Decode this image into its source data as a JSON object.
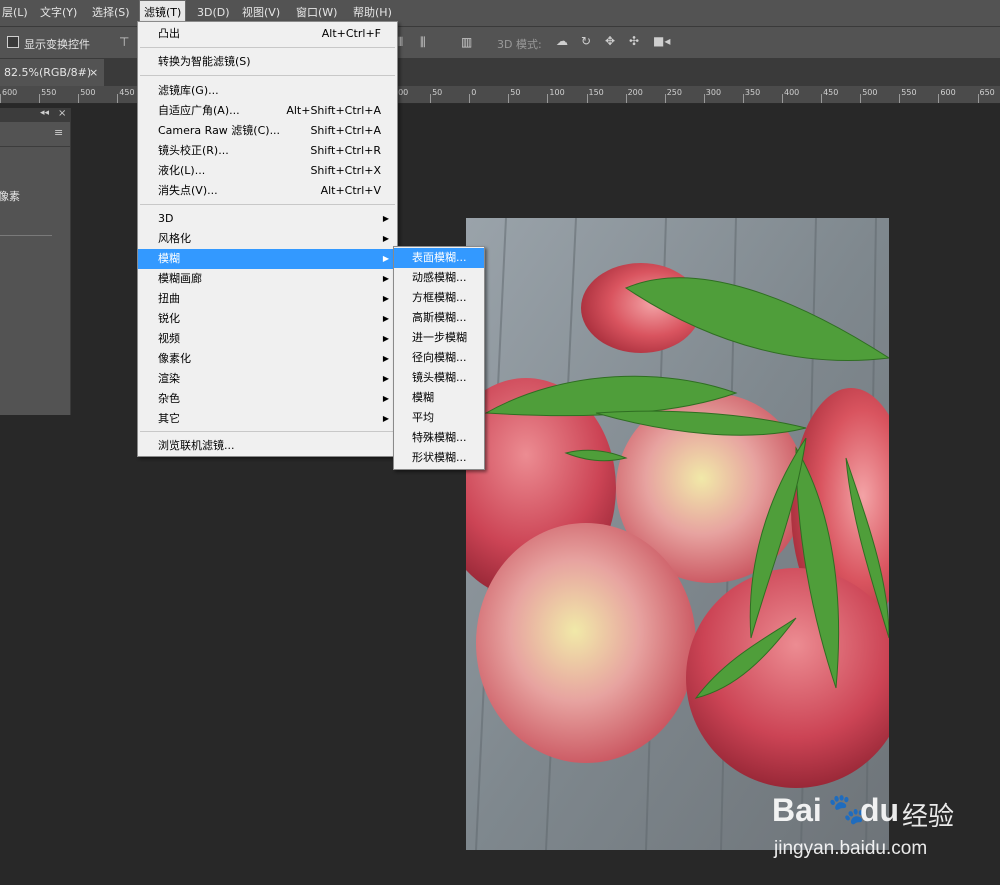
{
  "menubar": {
    "items": [
      {
        "label": "层(L)"
      },
      {
        "label": "文字(Y)"
      },
      {
        "label": "选择(S)"
      },
      {
        "label": "滤镜(T)"
      },
      {
        "label": "3D(D)"
      },
      {
        "label": "视图(V)"
      },
      {
        "label": "窗口(W)"
      },
      {
        "label": "帮助(H)"
      }
    ]
  },
  "options": {
    "show_transform_label": "显示变换控件",
    "mode_3d_label": "3D 模式:"
  },
  "document_tab": {
    "label": "82.5%(RGB/8#)",
    "close": "×"
  },
  "ruler": {
    "labels": [
      "600",
      "550",
      "500",
      "450",
      "400",
      "350",
      "300",
      "250",
      "200",
      "150",
      "100",
      "50",
      "0",
      "50",
      "100",
      "150",
      "200",
      "250",
      "300",
      "350",
      "400",
      "450",
      "500",
      "550",
      "600",
      "650"
    ]
  },
  "panel": {
    "text": "像素"
  },
  "filter_menu": {
    "items": [
      {
        "label": "凸出",
        "shortcut": "Alt+Ctrl+F"
      },
      {
        "label": "转换为智能滤镜(S)",
        "shortcut": ""
      },
      {
        "label": "滤镜库(G)...",
        "shortcut": ""
      },
      {
        "label": "自适应广角(A)...",
        "shortcut": "Alt+Shift+Ctrl+A"
      },
      {
        "label": "Camera Raw 滤镜(C)...",
        "shortcut": "Shift+Ctrl+A"
      },
      {
        "label": "镜头校正(R)...",
        "shortcut": "Shift+Ctrl+R"
      },
      {
        "label": "液化(L)...",
        "shortcut": "Shift+Ctrl+X"
      },
      {
        "label": "消失点(V)...",
        "shortcut": "Alt+Ctrl+V"
      },
      {
        "label": "3D"
      },
      {
        "label": "风格化"
      },
      {
        "label": "模糊"
      },
      {
        "label": "模糊画廊"
      },
      {
        "label": "扭曲"
      },
      {
        "label": "锐化"
      },
      {
        "label": "视频"
      },
      {
        "label": "像素化"
      },
      {
        "label": "渲染"
      },
      {
        "label": "杂色"
      },
      {
        "label": "其它"
      },
      {
        "label": "浏览联机滤镜..."
      }
    ],
    "arrow": "▶"
  },
  "blur_submenu": {
    "items": [
      "表面模糊...",
      "动感模糊...",
      "方框模糊...",
      "高斯模糊...",
      "进一步模糊",
      "径向模糊...",
      "镜头模糊...",
      "模糊",
      "平均",
      "特殊模糊...",
      "形状模糊..."
    ]
  },
  "watermark": {
    "brand": "Bai",
    "brand2": "du",
    "cn": "经验",
    "url": "jingyan.baidu.com"
  },
  "colors": {
    "highlight": "#3399ff",
    "annotation_arrow": "#e02020"
  }
}
